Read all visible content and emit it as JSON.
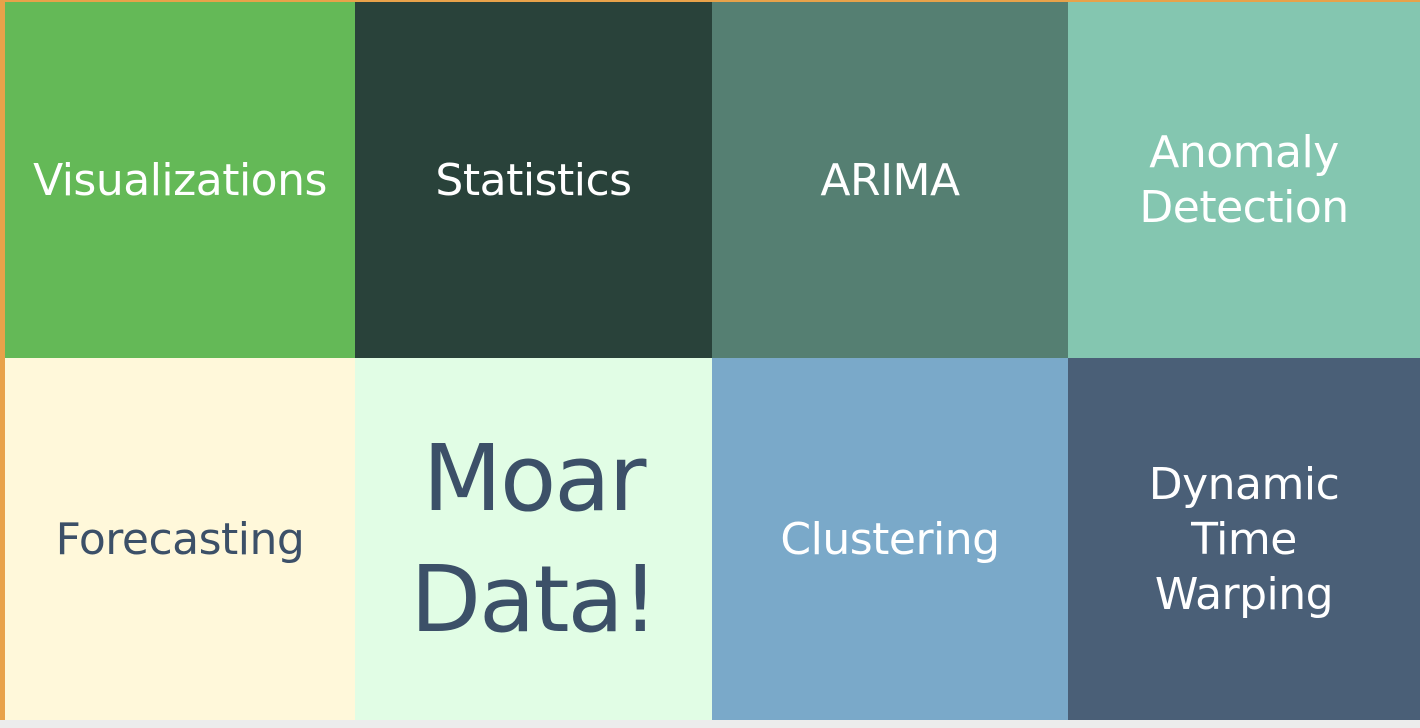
{
  "tiles": [
    {
      "label": "Visualizations",
      "bg": "#64b957",
      "color": "#ffffff"
    },
    {
      "label": "Statistics",
      "bg": "#29423a",
      "color": "#ffffff"
    },
    {
      "label": "ARIMA",
      "bg": "#557f72",
      "color": "#ffffff"
    },
    {
      "label": "Anomaly\nDetection",
      "bg": "#84c6b0",
      "color": "#ffffff"
    },
    {
      "label": "Forecasting",
      "bg": "#fff8da",
      "color": "#3c5068"
    },
    {
      "label": "Moar\nData!",
      "bg": "#e1fde5",
      "color": "#3c5068"
    },
    {
      "label": "Clustering",
      "bg": "#7aa9c9",
      "color": "#ffffff"
    },
    {
      "label": "Dynamic\nTime\nWarping",
      "bg": "#4a5f77",
      "color": "#ffffff"
    }
  ],
  "colors": {
    "accent_edge": "#e8a24a"
  }
}
